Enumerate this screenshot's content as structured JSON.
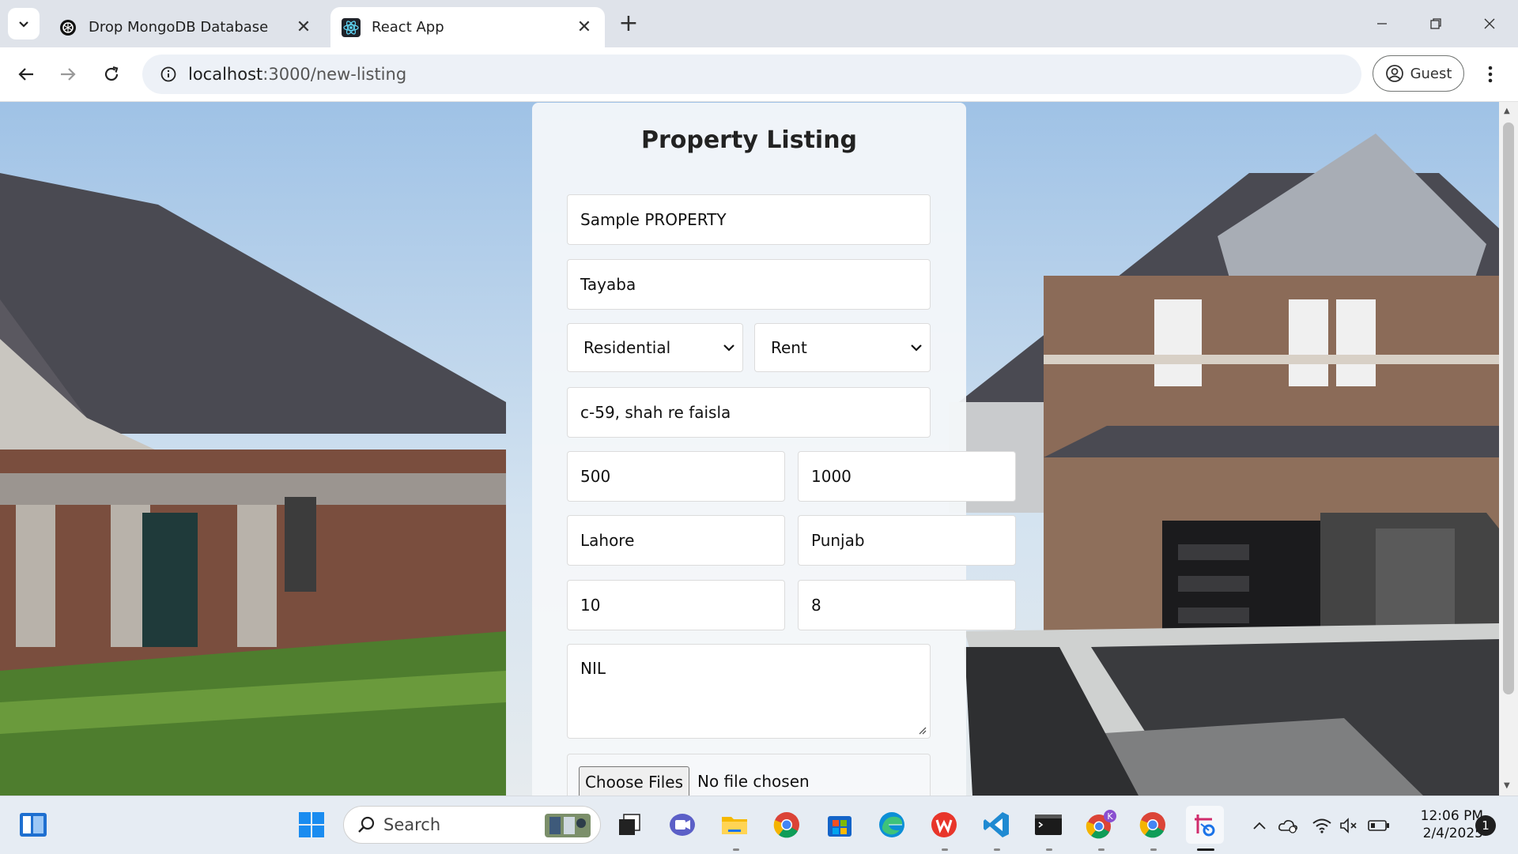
{
  "browser": {
    "tabs": [
      {
        "title": "Drop MongoDB Database",
        "favicon": "openai-icon",
        "active": false
      },
      {
        "title": "React App",
        "favicon": "react-icon",
        "active": true
      }
    ],
    "url_host": "localhost",
    "url_path": ":3000/new-listing",
    "profile_label": "Guest"
  },
  "form": {
    "title": "Property Listing",
    "name_value": "Sample PROPERTY",
    "owner_value": "Tayaba",
    "property_type": "Residential",
    "listing_type": "Rent",
    "address_value": "c-59, shah re faisla",
    "area_value": "500",
    "price_value": "1000",
    "city_value": "Lahore",
    "province_value": "Punjab",
    "field_a_value": "10",
    "field_b_value": "8",
    "description_value": "NIL",
    "choose_files_label": "Choose Files",
    "no_file_label": "No file chosen"
  },
  "taskbar": {
    "search_label": "Search",
    "time": "12:06 PM",
    "date": "2/4/2025",
    "notification_count": "1",
    "chrome_profile_badge": "K"
  },
  "colors": {
    "accent": "#0078d4",
    "chrome_frame": "#dfe3ea",
    "taskbar": "#e6ecf3"
  }
}
